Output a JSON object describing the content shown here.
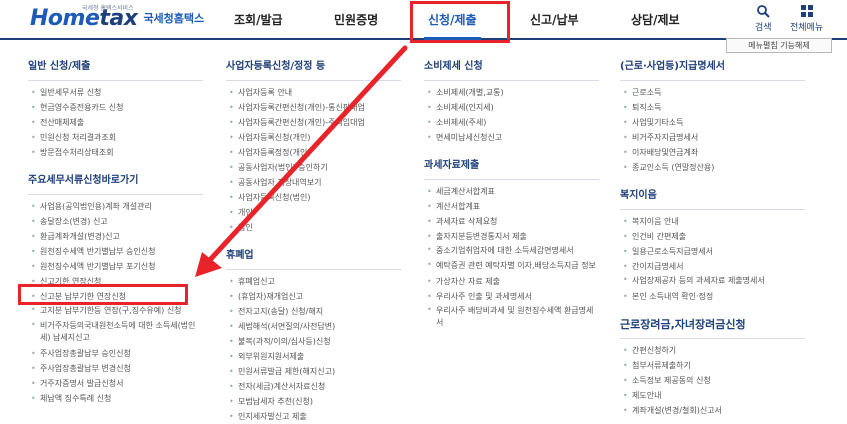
{
  "header": {
    "logo_tag": "국세청 홈택스서비스",
    "logo_home": "Home",
    "logo_tax": "tax",
    "logo_sub": "국세청홈택스",
    "nav": [
      "조회/발급",
      "민원증명",
      "신청/제출",
      "신고/납부",
      "상담/제보"
    ],
    "active_nav": "신청/제출",
    "search_label": "검색",
    "allmenu_label": "전체메뉴"
  },
  "menu_toggle_label": "메뉴펼침 기능해제",
  "accent_color": "#1d5bb8",
  "highlight_color": "#e8232a",
  "columns": {
    "c1": {
      "s1": {
        "title": "일반 신청/제출",
        "items": [
          "일반세무서류 신청",
          "현금영수증전용카드 신청",
          "전산매체제출",
          "민원신청 처리결과조회",
          "방문접수처리상태조회"
        ]
      },
      "s2": {
        "title": "주요세무서류신청바로가기",
        "items": [
          "사업용(공익법인용)계좌 개설관리",
          "송달장소(변경) 신고",
          "환급계좌개설(변경)신고",
          "원천징수세액 반기별납부 승인신청",
          "원천징수세액 반기별납부 포기신청",
          "신고기한 연장신청",
          "신고분 납부기한 연장신청",
          "고지분 납부기한등 연장(구,징수유예) 신청",
          "비거주자등의국내원천소득에 대한 소득세(법인세) 납세지신고",
          "주사업장총괄납부 승인신청",
          "주사업장총괄납부 변경신청",
          "거주자증명서 발급신청서",
          "체납액 징수특례 신청"
        ]
      }
    },
    "c2": {
      "s1": {
        "title": "사업자등록신청/정정 등",
        "items": [
          "사업자등록 안내",
          "사업자등록간편신청(개인)-통신판매업",
          "사업자등록간편신청(개인)-주택임대업",
          "사업자등록신청(개인)",
          "사업자등록정정(개인)",
          "공동사업자(법인) 승인하기",
          "공동사업자 저장내역보기",
          "사업자등록신청(법인)",
          "개인",
          "법인"
        ]
      },
      "s2": {
        "title": "휴폐업",
        "items": [
          "휴폐업신고",
          "(휴업자)재개업신고",
          "전자고지(송달) 신청/해지",
          "세법해석(서면질의/사전답변)",
          "불복(과적/이의/심사등)신청",
          "외부위원지원서제출",
          "민원서류발급 제한(해지신고)",
          "전자(세금)계산서자료신청",
          "모범납세자 추천(신청)",
          "인지세자발신고 제출"
        ]
      }
    },
    "c3": {
      "s1": {
        "title": "소비제세 신청",
        "items": [
          "소비제세(개별,교통)",
          "소비제세(인지세)",
          "소비제세(주세)",
          "면세미납세신청신고"
        ]
      },
      "s2": {
        "title": "과세자료제출",
        "items": [
          "세금계산서합계표",
          "계산서합계표",
          "과세자료 삭제요청",
          "출자지분등변경통지서 제출",
          "중소기업취업자에 대한 소득세감면명세서",
          "예탁증권 관련 예탁자별 이자,배당소득지급 정보",
          "가상자산 자료 제출",
          "우리사주 인출 및 과세명세서",
          "우리사주 배당비과세 및 원천징수세액 환급명세서"
        ]
      }
    },
    "c4": {
      "s1": {
        "title": "(근로·사업등)지급명세서",
        "items": [
          "근로소득",
          "퇴직소득",
          "사업및기타소득",
          "비거주자지급명세서",
          "이자배당및연금계좌",
          "종교인소득 (연말정산용)"
        ]
      },
      "s2": {
        "title": "복지이음",
        "items": [
          "복지이음 안내",
          "인건비 간편제출",
          "일용근로소득지급명세서",
          "간이지급명세서",
          "사업장제공자 등의 과세자료 제출명세서",
          "본인 소득내역 확인·정정"
        ]
      },
      "s3": {
        "title": "근로장려금,자녀장려금신청",
        "items": [
          "간편신청하기",
          "첨부서류제출하기",
          "소득정보 제공동의 신청",
          "제도안내",
          "계좌개설(변경/철회)신고서"
        ]
      }
    }
  }
}
